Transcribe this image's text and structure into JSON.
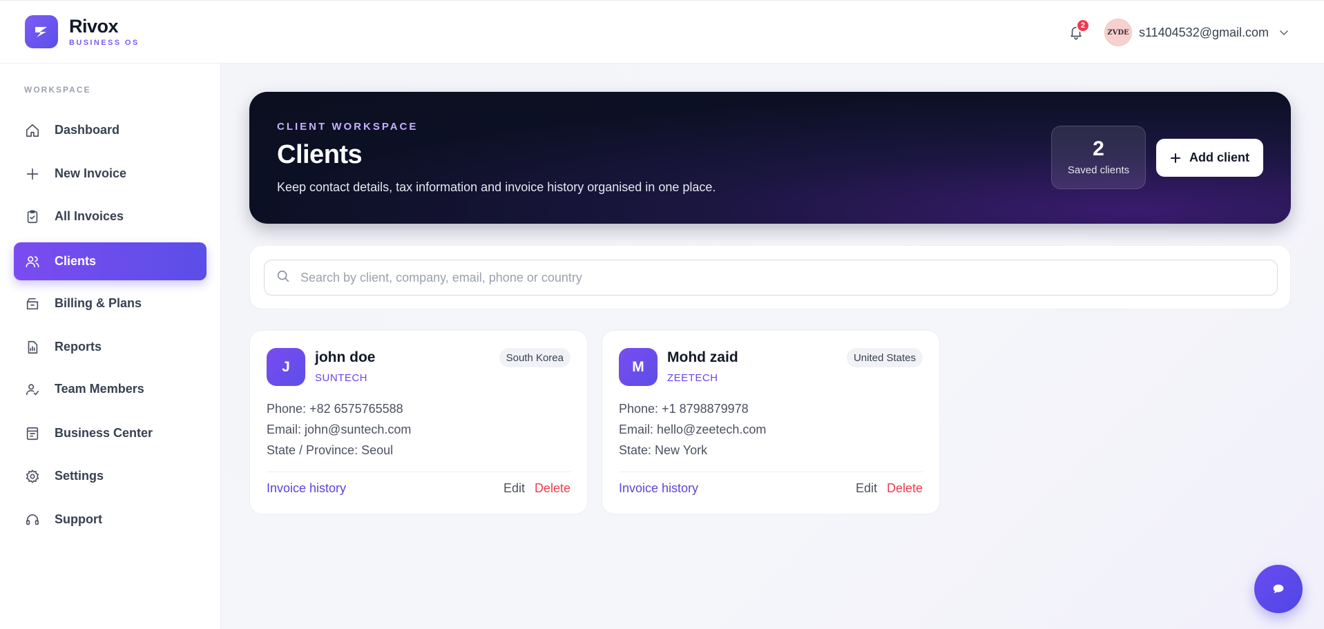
{
  "brand": {
    "name": "Rivox",
    "subtitle": "BUSINESS OS"
  },
  "header": {
    "notification_count": "2",
    "avatar_text": "ZVDE",
    "user_email": "s11404532@gmail.com"
  },
  "sidebar": {
    "section": "WORKSPACE",
    "items": [
      {
        "label": "Dashboard",
        "icon": "home-icon",
        "active": false
      },
      {
        "label": "New Invoice",
        "icon": "plus-icon",
        "active": false
      },
      {
        "label": "All Invoices",
        "icon": "clipboard-icon",
        "active": false
      },
      {
        "label": "Clients",
        "icon": "users-icon",
        "active": true
      },
      {
        "label": "Billing & Plans",
        "icon": "billing-icon",
        "active": false
      },
      {
        "label": "Reports",
        "icon": "report-icon",
        "active": false
      },
      {
        "label": "Team Members",
        "icon": "team-icon",
        "active": false
      },
      {
        "label": "Business Center",
        "icon": "business-icon",
        "active": false
      },
      {
        "label": "Settings",
        "icon": "gear-icon",
        "active": false
      },
      {
        "label": "Support",
        "icon": "headset-icon",
        "active": false
      }
    ]
  },
  "hero": {
    "eyebrow": "CLIENT WORKSPACE",
    "title": "Clients",
    "description": "Keep contact details, tax information and invoice history organised in one place.",
    "stat_value": "2",
    "stat_label": "Saved clients",
    "add_button": "Add client"
  },
  "search": {
    "placeholder": "Search by client, company, email, phone or country",
    "value": ""
  },
  "clients": [
    {
      "initial": "J",
      "name": "john doe",
      "company": "SUNTECH",
      "country": "South Korea",
      "phone": "Phone: +82 6575765588",
      "email": "Email: john@suntech.com",
      "state": "State / Province: Seoul",
      "history_label": "Invoice history",
      "edit_label": "Edit",
      "delete_label": "Delete"
    },
    {
      "initial": "M",
      "name": "Mohd zaid",
      "company": "ZEETECH",
      "country": "United States",
      "phone": "Phone: +1 8798879978",
      "email": "Email: hello@zeetech.com",
      "state": "State: New York",
      "history_label": "Invoice history",
      "edit_label": "Edit",
      "delete_label": "Delete"
    }
  ],
  "colors": {
    "accent": "#5b4ee8",
    "accent_light": "#7b4cf0",
    "danger": "#ef3b4f",
    "hero_dark": "#0b0f1f"
  }
}
